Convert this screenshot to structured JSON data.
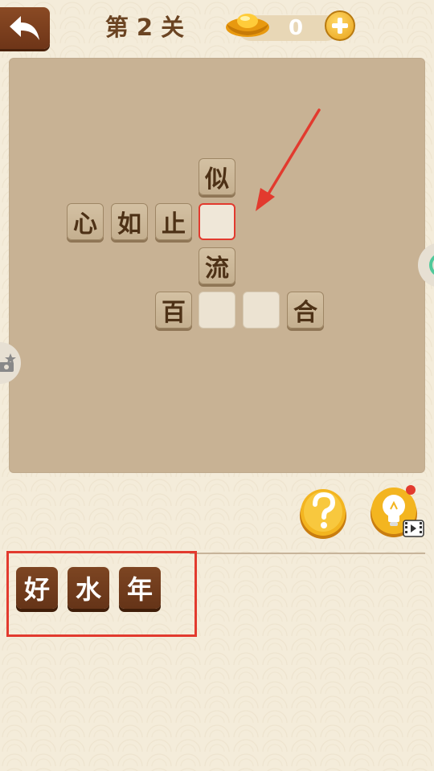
{
  "header": {
    "level_label": "第 2 关",
    "coins": "0"
  },
  "board": {
    "tiles": {
      "si": "似",
      "xin": "心",
      "ru": "如",
      "zhi": "止",
      "liu": "流",
      "bai": "百",
      "he": "合"
    }
  },
  "choices": [
    "好",
    "水",
    "年"
  ],
  "colors": {
    "accent_red": "#e23a2e",
    "tile_brown": "#6e3518",
    "gold": "#f2b318"
  },
  "icons": [
    "back-arrow-icon",
    "gold-ingot-icon",
    "plus-icon",
    "question-icon",
    "lightbulb-icon",
    "video-icon"
  ]
}
